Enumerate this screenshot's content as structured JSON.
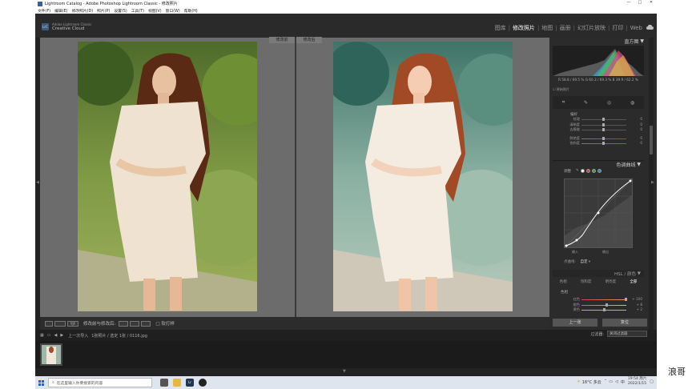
{
  "window": {
    "title": "Lightroom Catalog - Adobe Photoshop Lightroom Classic - 修改照片",
    "controls": [
      "—",
      "□",
      "✕"
    ]
  },
  "menu": [
    "文件(F)",
    "编辑(E)",
    "修改照片(D)",
    "照片(P)",
    "设置(S)",
    "工具(T)",
    "视图(V)",
    "窗口(W)",
    "帮助(H)"
  ],
  "identity": {
    "logo": "LrC",
    "brand_line1": "Adobe Lightroom Classic",
    "brand_line2": "Creative Cloud"
  },
  "modules": [
    "图库",
    "修改照片",
    "地图",
    "画册",
    "幻灯片放映",
    "打印",
    "Web"
  ],
  "active_module": "修改照片",
  "compare": {
    "before_label": "修改前",
    "after_label": "修改后"
  },
  "toolbar": {
    "view_label": "Y|Y",
    "compare_label": "修改前与修改后:",
    "softproof_label": "软打样"
  },
  "histogram": {
    "title": "直方图",
    "info": "R  58.8 / 69.5  %   G  60.3 / 69.3  %   B  39.9 / 62.2  %",
    "original_label": "原始照片"
  },
  "presence": {
    "title": "偏好",
    "sliders": [
      {
        "label": "纹理",
        "value": "0",
        "pos": 0.5
      },
      {
        "label": "清晰度",
        "value": "0",
        "pos": 0.5
      },
      {
        "label": "去朦胧",
        "value": "0",
        "pos": 0.5
      },
      {
        "label": "鲜艳度",
        "value": "0",
        "pos": 0.5
      },
      {
        "label": "饱和度",
        "value": "0",
        "pos": 0.5
      }
    ]
  },
  "tone_curve": {
    "title": "色调曲线",
    "adjust_label": "调整",
    "channel_colors": [
      "#ffffff",
      "#e53935",
      "#43a047",
      "#1e88e5"
    ],
    "input_label": "输入",
    "output_label": "输出",
    "point_curve_label": "点曲线:",
    "point_curve_value": "自定"
  },
  "hsl": {
    "title": "HSL / 颜色",
    "tabs": [
      "色相",
      "饱和度",
      "明亮度",
      "全部"
    ],
    "sub_label": "色相",
    "rows": [
      {
        "label": "红色",
        "value": "+ 100",
        "pos": 0.98
      },
      {
        "label": "橙色",
        "value": "+ 8",
        "pos": 0.55
      },
      {
        "label": "黄色",
        "value": "+ 2",
        "pos": 0.52
      }
    ]
  },
  "actions": {
    "previous": "上一张",
    "reset": "复位"
  },
  "filmstrip": {
    "source": "上一次导入",
    "info": "1张照片 / 选定 1张 / 0116.jpg",
    "filter_label": "过滤器:",
    "filter_value": "关闭过滤器"
  },
  "taskbar": {
    "search_placeholder": "在这里输入你要搜索的内容",
    "weather": "16°C 多云",
    "language": "中",
    "time": "19:54 周六",
    "date": "2022/1/15"
  },
  "watermark": "浪哥"
}
